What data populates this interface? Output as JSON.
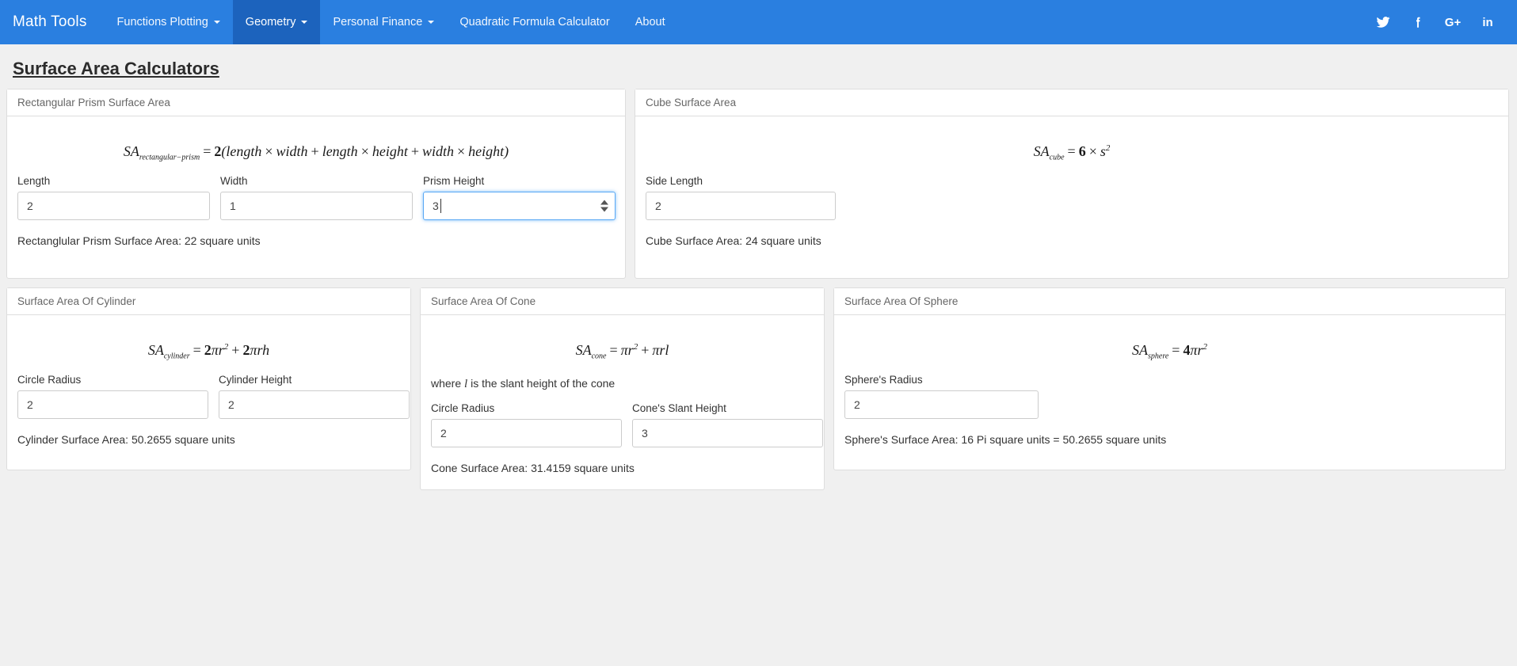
{
  "navbar": {
    "brand": "Math Tools",
    "items": [
      {
        "label": "Functions Plotting",
        "has_caret": true,
        "active": false
      },
      {
        "label": "Geometry",
        "has_caret": true,
        "active": true
      },
      {
        "label": "Personal Finance",
        "has_caret": true,
        "active": false
      },
      {
        "label": "Quadratic Formula Calculator",
        "has_caret": false,
        "active": false
      },
      {
        "label": "About",
        "has_caret": false,
        "active": false
      }
    ],
    "social": [
      {
        "name": "twitter-icon",
        "label": "Twitter"
      },
      {
        "name": "facebook-icon",
        "label": "Facebook"
      },
      {
        "name": "google-plus-icon",
        "label": "G+"
      },
      {
        "name": "linkedin-icon",
        "label": "in"
      }
    ],
    "background_color": "#2a7fe0",
    "active_color": "#1c63bd"
  },
  "page": {
    "title": "Surface Area Calculators"
  },
  "panels": {
    "prism": {
      "heading": "Rectangular Prism Surface Area",
      "formula_text": "SA_rectangular_prism = 2(length × width + length × height + width × height)",
      "fields": [
        {
          "label": "Length",
          "value": "2",
          "focused": false
        },
        {
          "label": "Width",
          "value": "1",
          "focused": false
        },
        {
          "label": "Prism Height",
          "value": "3",
          "focused": true
        }
      ],
      "result": "Rectanglular Prism Surface Area: 22 square units"
    },
    "cube": {
      "heading": "Cube Surface Area",
      "formula_text": "SA_cube = 6 × s²",
      "fields": [
        {
          "label": "Side Length",
          "value": "2",
          "focused": false
        }
      ],
      "result": "Cube Surface Area: 24 square units"
    },
    "cylinder": {
      "heading": "Surface Area Of Cylinder",
      "formula_text": "SA_cylinder = 2πr² + 2πrh",
      "fields": [
        {
          "label": "Circle Radius",
          "value": "2",
          "focused": false
        },
        {
          "label": "Cylinder Height",
          "value": "2",
          "focused": false
        }
      ],
      "result": "Cylinder Surface Area: 50.2655 square units"
    },
    "cone": {
      "heading": "Surface Area Of Cone",
      "formula_text": "SA_cone = πr² + πrl",
      "note_prefix": "where ",
      "note_symbol": "l",
      "note_suffix": " is the slant height of the cone",
      "fields": [
        {
          "label": "Circle Radius",
          "value": "2",
          "focused": false
        },
        {
          "label": "Cone's Slant Height",
          "value": "3",
          "focused": false
        }
      ],
      "result": "Cone Surface Area: 31.4159 square units"
    },
    "sphere": {
      "heading": "Surface Area Of Sphere",
      "formula_text": "SA_sphere = 4πr²",
      "fields": [
        {
          "label": "Sphere's Radius",
          "value": "2",
          "focused": false
        }
      ],
      "result": "Sphere's Surface Area: 16 Pi square units = 50.2655 square units"
    }
  },
  "formula_parts": {
    "prism": {
      "sa": "SA",
      "sub": "rectangular−prism",
      "eq": "=",
      "two": "2",
      "open": "(",
      "length1": "length",
      "times1": "×",
      "width1": "width",
      "plus1": "+",
      "length2": "length",
      "times2": "×",
      "height1": "height",
      "plus2": "+",
      "width2": "width",
      "times3": "×",
      "height2": "height",
      "close": ")"
    },
    "cube": {
      "sa": "SA",
      "sub": "cube",
      "eq": "=",
      "six": "6",
      "times": "×",
      "s": "s",
      "pow": "2"
    },
    "cylinder": {
      "sa": "SA",
      "sub": "cylinder",
      "eq": "=",
      "two1": "2",
      "pi1": "π",
      "r1": "r",
      "pow": "2",
      "plus": "+",
      "two2": "2",
      "pi2": "π",
      "r2": "r",
      "h": "h"
    },
    "cone": {
      "sa": "SA",
      "sub": "cone",
      "eq": "=",
      "pi1": "π",
      "r1": "r",
      "pow": "2",
      "plus": "+",
      "pi2": "π",
      "r2": "r",
      "l": "l"
    },
    "sphere": {
      "sa": "SA",
      "sub": "sphere",
      "eq": "=",
      "four": "4",
      "pi": "π",
      "r": "r",
      "pow": "2"
    }
  }
}
